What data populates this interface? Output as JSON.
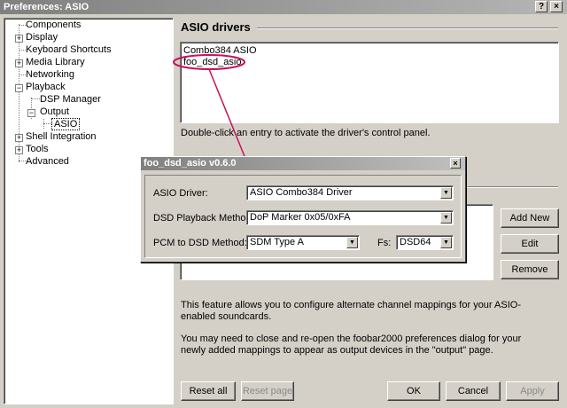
{
  "window": {
    "title": "Preferences: ASIO",
    "help_btn": "?",
    "close_btn": "×"
  },
  "tree": {
    "items": [
      {
        "label": "Components"
      },
      {
        "label": "Display",
        "expander": "+"
      },
      {
        "label": "Keyboard Shortcuts"
      },
      {
        "label": "Media Library",
        "expander": "+"
      },
      {
        "label": "Networking"
      },
      {
        "label": "Playback",
        "expander": "−"
      },
      {
        "label": "DSP Manager"
      },
      {
        "label": "Output",
        "expander": "−"
      },
      {
        "label": "ASIO",
        "selected": true
      },
      {
        "label": "Shell Integration",
        "expander": "+"
      },
      {
        "label": "Tools",
        "expander": "+"
      },
      {
        "label": "Advanced"
      }
    ]
  },
  "asio": {
    "heading": "ASIO drivers",
    "drivers": [
      "Combo384 ASIO",
      "foo_dsd_asio"
    ],
    "hint": "Double-click an entry to activate the driver's control panel."
  },
  "mappings": {
    "add_label": "Add New",
    "edit_label": "Edit",
    "remove_label": "Remove",
    "note1": "This feature allows you to configure alternate channel mappings for your ASIO-enabled soundcards.",
    "note2": "You may need to close and re-open the foobar2000 preferences dialog for your newly added mappings to appear as output devices in the \"output\" page."
  },
  "footer": {
    "reset_all": "Reset all",
    "reset_page": "Reset page",
    "ok": "OK",
    "cancel": "Cancel",
    "apply": "Apply"
  },
  "dialog": {
    "title": "foo_dsd_asio  v0.6.0",
    "close_btn": "×",
    "driver_label": "ASIO Driver:",
    "driver_value": "ASIO Combo384 Driver",
    "method_label": "DSD Playback Method:",
    "method_value": "DoP Marker 0x05/0xFA",
    "pcm_label": "PCM to DSD Method:",
    "pcm_value": "SDM Type A",
    "fs_label": "Fs:",
    "fs_value": "DSD64"
  },
  "colors": {
    "annotation": "#c8105a",
    "titlebar": "#808080"
  }
}
